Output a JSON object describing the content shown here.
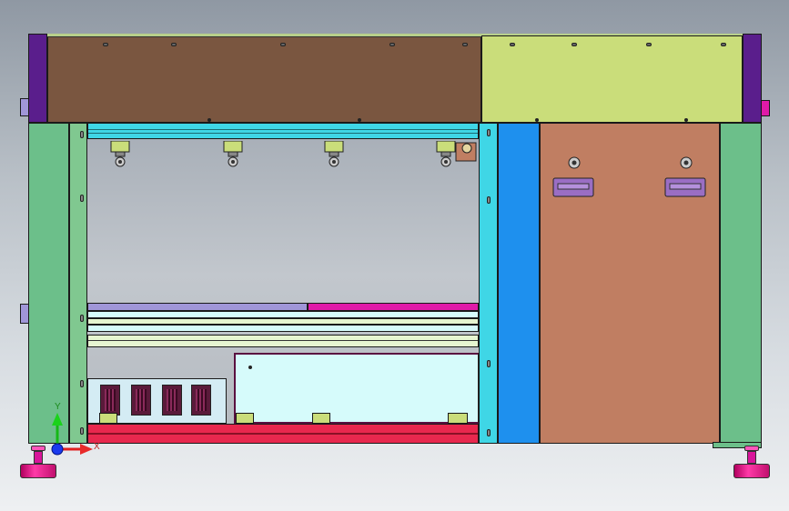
{
  "view": {
    "triad": {
      "x_label": "X",
      "y_label": "Y"
    },
    "colors": {
      "frame_purple": "#5a1e8c",
      "top_brown": "#7a5640",
      "top_lime": "#cadd7a",
      "side_green": "#6cbf8a",
      "inner_green": "#80c890",
      "cyan_bar": "#3fd6e6",
      "blue_column": "#1e90ee",
      "copper_panel": "#c07e62",
      "red_base": "#e8284e",
      "magenta": "#e01aa8",
      "lavender": "#a096d8",
      "pale_cyan": "#d6fbfb",
      "pale_pcb": "#d4ecf4",
      "foot_pink": "#e0208c"
    },
    "icons": [
      "coordinate-triad-icon",
      "leveling-foot-icon",
      "bracket-icon",
      "handle-icon"
    ]
  }
}
